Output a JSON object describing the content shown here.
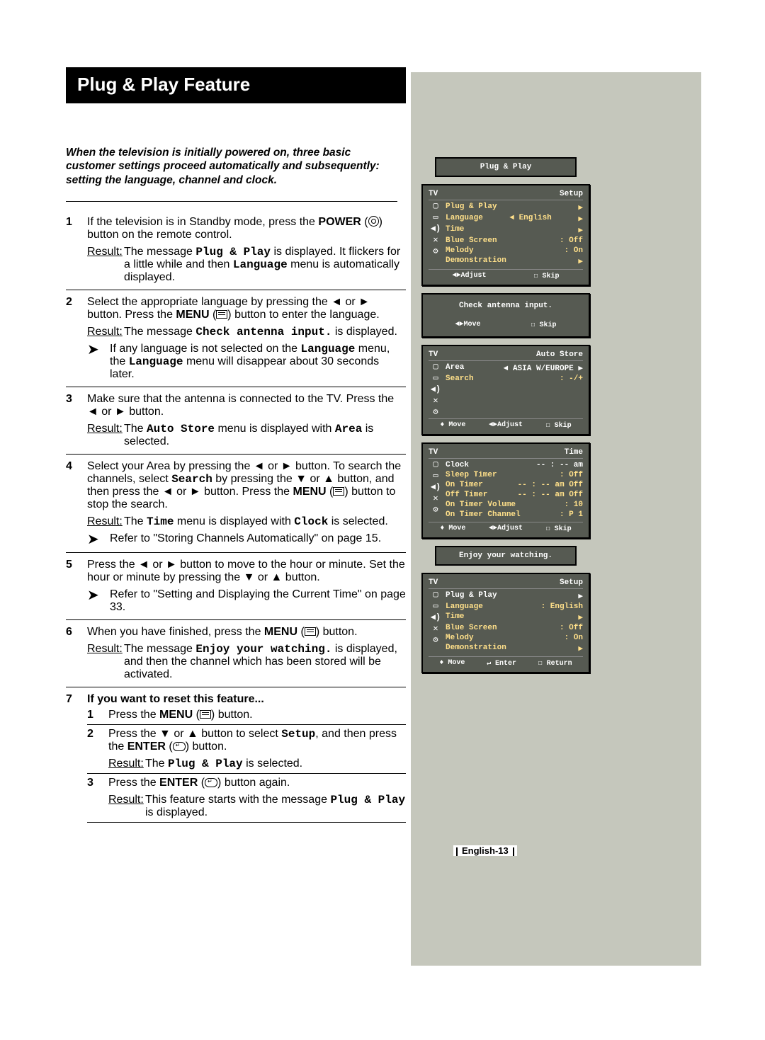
{
  "title": "Plug & Play Feature",
  "intro": "When the television is initially powered on, three basic customer settings proceed automatically and subsequently: setting the language, channel and clock.",
  "steps": {
    "s1": {
      "num": "1",
      "text_a": "If the television is in Standby mode, press the ",
      "text_b": "POWER",
      "text_c": " (",
      "text_d": ") button on the remote control.",
      "result_a": "The message ",
      "result_mono1": "Plug & Play",
      "result_b": " is displayed. It flickers for a little while and then ",
      "result_mono2": "Language",
      "result_c": " menu is automatically displayed."
    },
    "s2": {
      "num": "2",
      "text_a": "Select the appropriate language by pressing the ◄ or ► button. Press the ",
      "text_b": "MENU",
      "text_c": " (",
      "text_d": ") button to enter the language.",
      "result_a": "The message ",
      "result_mono": "Check antenna input.",
      "result_b": " is displayed.",
      "note_a": "If any language is not selected on the ",
      "note_mono": "Language",
      "note_b": " menu, the ",
      "note_mono2": "Language",
      "note_c": " menu will disappear about 30 seconds later."
    },
    "s3": {
      "num": "3",
      "text": "Make sure that the antenna is connected to the TV. Press the ◄ or ► button.",
      "result_a": "The ",
      "result_mono1": "Auto Store",
      "result_b": " menu is displayed with ",
      "result_mono2": "Area",
      "result_c": " is selected."
    },
    "s4": {
      "num": "4",
      "text_a": "Select your Area by pressing the ◄ or ► button. To search the channels, select ",
      "text_mono1": "Search",
      "text_b": " by pressing the ▼ or ▲ button, and then press the ◄ or ► button. Press the ",
      "text_bold": "MENU",
      "text_c": " (",
      "text_d": ") button to stop the search.",
      "result_a": "The ",
      "result_mono1": "Time",
      "result_b": " menu is displayed with ",
      "result_mono2": "Clock",
      "result_c": " is selected.",
      "note": "Refer to \"Storing Channels Automatically\" on page 15."
    },
    "s5": {
      "num": "5",
      "text": "Press the ◄ or ► button to move to the hour or minute. Set the hour or minute by pressing the ▼ or ▲ button.",
      "note": "Refer to \"Setting and Displaying the Current Time\" on page 33."
    },
    "s6": {
      "num": "6",
      "text_a": "When you have finished, press the ",
      "text_b": "MENU",
      "text_c": " (",
      "text_d": ") button.",
      "result_a": "The message ",
      "result_mono": "Enjoy your watching.",
      "result_b": " is displayed, and then the channel which has been stored will be activated."
    },
    "s7": {
      "num": "7",
      "heading": "If you want to reset this feature...",
      "sub1_num": "1",
      "sub1_a": "Press the ",
      "sub1_b": "MENU",
      "sub1_c": " (",
      "sub1_d": ") button.",
      "sub2_num": "2",
      "sub2_a": "Press the ▼ or ▲ button to select ",
      "sub2_mono": "Setup",
      "sub2_b": ", and then press the ",
      "sub2_bold": "ENTER",
      "sub2_c": " (",
      "sub2_d": ") button.",
      "sub2_result_a": "The ",
      "sub2_result_mono": "Plug & Play",
      "sub2_result_b": " is selected.",
      "sub3_num": "3",
      "sub3_a": "Press the ",
      "sub3_b": "ENTER",
      "sub3_c": " (",
      "sub3_d": ") button again.",
      "sub3_result_a": "This feature starts with the message ",
      "sub3_result_mono": "Plug & Play",
      "sub3_result_b": " is displayed."
    }
  },
  "result_label": "Result:",
  "osd": {
    "box0": {
      "title": "Plug & Play"
    },
    "box1": {
      "tv": "TV",
      "header": "Setup",
      "l1": "Plug & Play",
      "r1": "▶",
      "l2": "Language",
      "m2": "◄ English",
      "r2": "▶",
      "l3": "Time",
      "r3": "▶",
      "l4": "Blue Screen",
      "r4": ": Off",
      "l5": "Melody",
      "r5": ": On",
      "l6": "Demonstration",
      "r6": "▶",
      "f1": "◄►Adjust",
      "f2": "☐ Skip"
    },
    "box2": {
      "msg": "Check antenna input.",
      "f1": "◄►Move",
      "f2": "☐ Skip"
    },
    "box3": {
      "tv": "TV",
      "header": "Auto Store",
      "l1": "Area",
      "r1": "◄ ASIA W/EUROPE ▶",
      "l2": "Search",
      "r2": ": -/+",
      "f0": "♦ Move",
      "f1": "◄►Adjust",
      "f2": "☐ Skip"
    },
    "box4": {
      "tv": "TV",
      "header": "Time",
      "l1": "Clock",
      "r1": "-- : -- am",
      "l2": "Sleep Timer",
      "r2": ": Off",
      "l3": "On Timer",
      "r3": "-- : -- am Off",
      "l4": "Off Timer",
      "r4": "-- : -- am Off",
      "l5": "On Timer Volume",
      "r5": ": 10",
      "l6": "On Timer Channel",
      "r6": ": P 1",
      "f0": "♦ Move",
      "f1": "◄►Adjust",
      "f2": "☐ Skip"
    },
    "box5": {
      "msg": "Enjoy your watching."
    },
    "box6": {
      "tv": "TV",
      "header": "Setup",
      "l1": "Plug & Play",
      "r1": "▶",
      "l2": "Language",
      "r2": ": English",
      "l3": "Time",
      "r3": "▶",
      "l4": "Blue Screen",
      "r4": ": Off",
      "l5": "Melody",
      "r5": ": On",
      "l6": "Demonstration",
      "r6": "▶",
      "f0": "♦ Move",
      "f1": "↵ Enter",
      "f2": "☐ Return"
    }
  },
  "pagenum": "English-13"
}
